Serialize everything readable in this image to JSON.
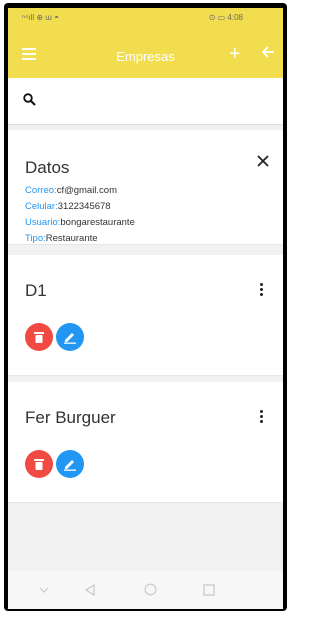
{
  "status_bar": {
    "left": "ⁿ⁴ıll ⊕ ɯ ◓",
    "right": "⊙ ▭ 4:08"
  },
  "app_bar": {
    "title": "Empresas"
  },
  "search": {
    "value": "",
    "placeholder": ""
  },
  "details": {
    "title": "Datos",
    "fields": [
      {
        "label": "Correo:",
        "value": "cf@gmail.com"
      },
      {
        "label": "Celular:",
        "value": "3122345678"
      },
      {
        "label": "Usuario:",
        "value": "bongarestaurante"
      },
      {
        "label": "Tipo:",
        "value": "Restaurante"
      }
    ]
  },
  "companies": [
    {
      "name": "D1"
    },
    {
      "name": "Fer Burguer"
    }
  ],
  "colors": {
    "app_bar": "#f2dd4f",
    "delete": "#f14a43",
    "edit": "#2196f3",
    "label": "#2196f3"
  }
}
